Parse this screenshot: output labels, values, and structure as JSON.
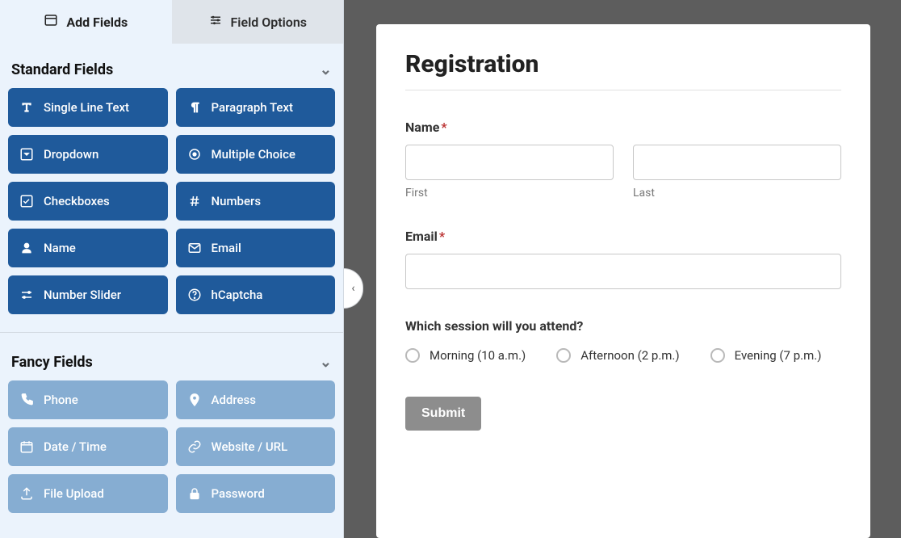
{
  "tabs": {
    "add_fields": "Add Fields",
    "field_options": "Field Options"
  },
  "sections": {
    "standard": {
      "title": "Standard Fields",
      "items": [
        {
          "name": "single-line-text",
          "label": "Single Line Text",
          "icon": "text-t"
        },
        {
          "name": "paragraph-text",
          "label": "Paragraph Text",
          "icon": "pilcrow"
        },
        {
          "name": "dropdown",
          "label": "Dropdown",
          "icon": "caret-square"
        },
        {
          "name": "multiple-choice",
          "label": "Multiple Choice",
          "icon": "radio"
        },
        {
          "name": "checkboxes",
          "label": "Checkboxes",
          "icon": "check-square"
        },
        {
          "name": "numbers",
          "label": "Numbers",
          "icon": "hash"
        },
        {
          "name": "name",
          "label": "Name",
          "icon": "user"
        },
        {
          "name": "email",
          "label": "Email",
          "icon": "mail"
        },
        {
          "name": "number-slider",
          "label": "Number Slider",
          "icon": "sliders"
        },
        {
          "name": "hcaptcha",
          "label": "hCaptcha",
          "icon": "help"
        }
      ]
    },
    "fancy": {
      "title": "Fancy Fields",
      "items": [
        {
          "name": "phone",
          "label": "Phone",
          "icon": "phone"
        },
        {
          "name": "address",
          "label": "Address",
          "icon": "pin"
        },
        {
          "name": "date-time",
          "label": "Date / Time",
          "icon": "calendar"
        },
        {
          "name": "website-url",
          "label": "Website / URL",
          "icon": "link"
        },
        {
          "name": "file-upload",
          "label": "File Upload",
          "icon": "upload"
        },
        {
          "name": "password",
          "label": "Password",
          "icon": "lock"
        }
      ]
    }
  },
  "form": {
    "title": "Registration",
    "name": {
      "label": "Name",
      "first_sub": "First",
      "last_sub": "Last"
    },
    "email": {
      "label": "Email"
    },
    "session": {
      "label": "Which session will you attend?",
      "options": [
        "Morning (10 a.m.)",
        "Afternoon (2 p.m.)",
        "Evening (7 p.m.)"
      ]
    },
    "submit_label": "Submit"
  }
}
